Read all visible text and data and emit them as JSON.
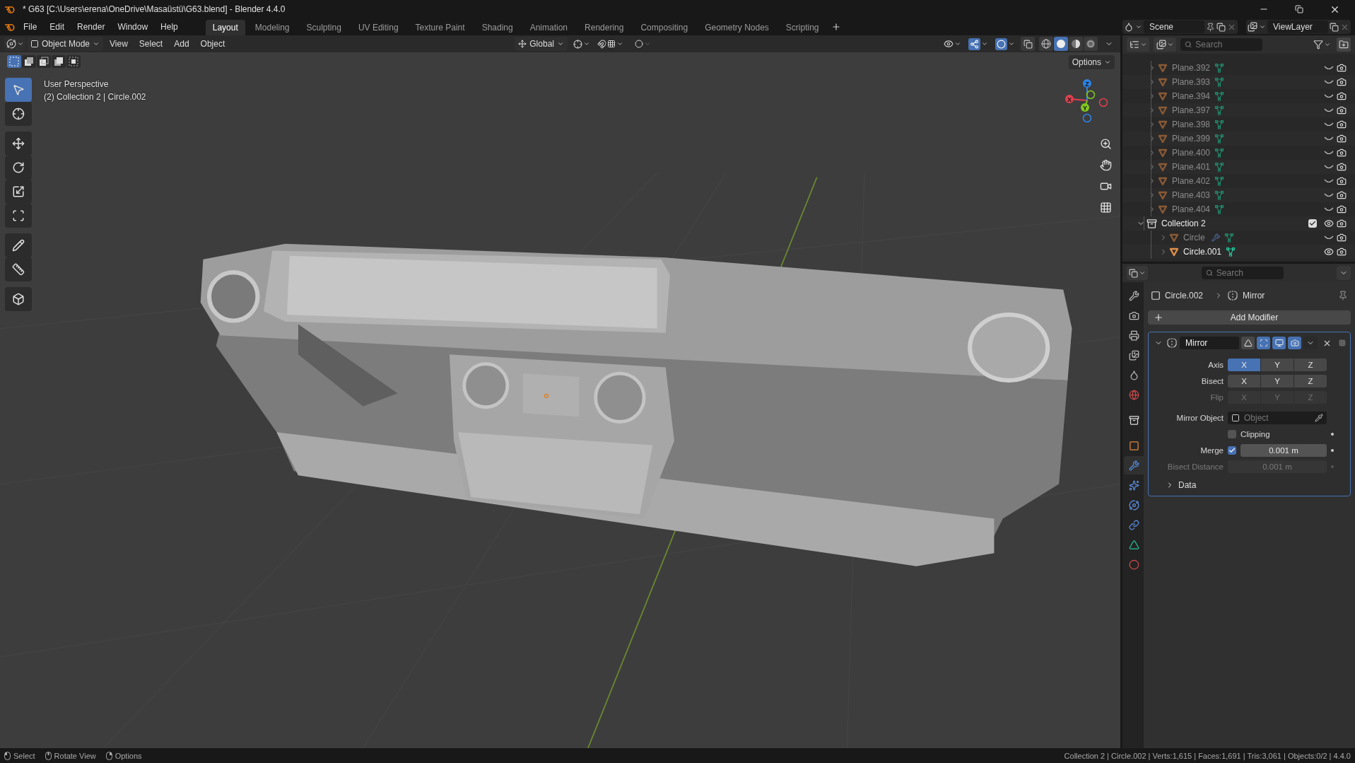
{
  "window": {
    "title": "* G63 [C:\\Users\\erena\\OneDrive\\Masaüstü\\G63.blend] - Blender 4.4.0"
  },
  "menu": [
    "File",
    "Edit",
    "Render",
    "Window",
    "Help"
  ],
  "workspaces": [
    {
      "label": "Layout",
      "selected": true
    },
    {
      "label": "Modeling",
      "selected": false
    },
    {
      "label": "Sculpting",
      "selected": false
    },
    {
      "label": "UV Editing",
      "selected": false
    },
    {
      "label": "Texture Paint",
      "selected": false
    },
    {
      "label": "Shading",
      "selected": false
    },
    {
      "label": "Animation",
      "selected": false
    },
    {
      "label": "Rendering",
      "selected": false
    },
    {
      "label": "Compositing",
      "selected": false
    },
    {
      "label": "Geometry Nodes",
      "selected": false
    },
    {
      "label": "Scripting",
      "selected": false
    }
  ],
  "scene": "Scene",
  "view_layer": "ViewLayer",
  "viewport": {
    "gizmos": true,
    "overlays": true,
    "mode": "Object Mode",
    "menus": [
      "View",
      "Select",
      "Add",
      "Object"
    ],
    "orientation": "Global",
    "options": "Options",
    "select_modes": [
      {
        "kind": "set",
        "selected": true
      },
      {
        "kind": "extend",
        "selected": false
      },
      {
        "kind": "subtract",
        "selected": false
      },
      {
        "kind": "difference",
        "selected": false
      },
      {
        "kind": "intersect",
        "selected": false
      }
    ],
    "shading": [
      {
        "kind": "wireframe",
        "selected": false
      },
      {
        "kind": "solid",
        "selected": true
      },
      {
        "kind": "material",
        "selected": false
      },
      {
        "kind": "rendered",
        "selected": false
      }
    ],
    "overlay_text": [
      "User Perspective",
      "(2) Collection 2 | Circle.002"
    ],
    "tools": [
      {
        "kind": "select",
        "selected": true
      },
      {
        "kind": "cursor",
        "selected": false
      },
      {
        "kind": "move",
        "selected": false
      },
      {
        "kind": "rotate",
        "selected": false
      },
      {
        "kind": "scale",
        "selected": false
      },
      {
        "kind": "transform",
        "selected": false
      },
      {
        "kind": "annotate",
        "selected": false
      },
      {
        "kind": "measure",
        "selected": false
      },
      {
        "kind": "add_cube",
        "selected": false
      }
    ],
    "gizmo_axes": [
      {
        "label": "X",
        "color": "#e0404f"
      },
      {
        "label": "Y",
        "color": "#82c81e"
      },
      {
        "label": "Z",
        "color": "#2f83e3"
      }
    ]
  },
  "outliner": {
    "search": {
      "placeholder": "Search"
    },
    "items": [
      {
        "kind": "mesh",
        "name": "Plane.392",
        "visible": false,
        "modifier": false
      },
      {
        "kind": "mesh",
        "name": "Plane.393",
        "visible": false,
        "modifier": false
      },
      {
        "kind": "mesh",
        "name": "Plane.394",
        "visible": false,
        "modifier": false
      },
      {
        "kind": "mesh",
        "name": "Plane.397",
        "visible": false,
        "modifier": false
      },
      {
        "kind": "mesh",
        "name": "Plane.398",
        "visible": false,
        "modifier": false
      },
      {
        "kind": "mesh",
        "name": "Plane.399",
        "visible": false,
        "modifier": false
      },
      {
        "kind": "mesh",
        "name": "Plane.400",
        "visible": false,
        "modifier": false
      },
      {
        "kind": "mesh",
        "name": "Plane.401",
        "visible": false,
        "modifier": false
      },
      {
        "kind": "mesh",
        "name": "Plane.402",
        "visible": false,
        "modifier": false
      },
      {
        "kind": "mesh",
        "name": "Plane.403",
        "visible": false,
        "modifier": false
      },
      {
        "kind": "mesh",
        "name": "Plane.404",
        "visible": false,
        "modifier": false
      },
      {
        "kind": "collection",
        "name": "Collection 2",
        "visible": true,
        "checked": true,
        "expanded": true,
        "children": [
          {
            "kind": "mesh",
            "name": "Circle",
            "visible": false,
            "modifier": true
          },
          {
            "kind": "mesh",
            "name": "Circle.001",
            "visible": true,
            "modifier": false
          }
        ]
      }
    ]
  },
  "properties": {
    "search": {
      "placeholder": "Search"
    },
    "tabs": [
      {
        "kind": "tool",
        "selected": false
      },
      {
        "kind": "render",
        "selected": false
      },
      {
        "kind": "output",
        "selected": false
      },
      {
        "kind": "view_layer",
        "selected": false
      },
      {
        "kind": "scene",
        "selected": false
      },
      {
        "kind": "world",
        "selected": false
      },
      {
        "kind": "collection",
        "selected": false
      },
      {
        "kind": "object",
        "selected": false
      },
      {
        "kind": "modifiers",
        "selected": true
      },
      {
        "kind": "particles",
        "selected": false
      },
      {
        "kind": "physics",
        "selected": false
      },
      {
        "kind": "constraints",
        "selected": false
      },
      {
        "kind": "data",
        "selected": false
      },
      {
        "kind": "material",
        "selected": false
      }
    ],
    "breadcrumb": {
      "object": "Circle.002",
      "modifier": "Mirror"
    },
    "add_modifier": "Add Modifier",
    "modifier": {
      "name": "Mirror",
      "expanded": true,
      "toggles": [
        {
          "kind": "edit_mode",
          "on": false
        },
        {
          "kind": "on_cage",
          "on": true
        },
        {
          "kind": "viewport",
          "on": true
        },
        {
          "kind": "render",
          "on": true
        }
      ],
      "rows": [
        {
          "kind": "axes",
          "label": "Axis",
          "disabled": false,
          "buttons": [
            {
              "label": "X",
              "on": true
            },
            {
              "label": "Y",
              "on": false
            },
            {
              "label": "Z",
              "on": false
            }
          ]
        },
        {
          "kind": "axes",
          "label": "Bisect",
          "disabled": false,
          "buttons": [
            {
              "label": "X",
              "on": false
            },
            {
              "label": "Y",
              "on": false
            },
            {
              "label": "Z",
              "on": false
            }
          ]
        },
        {
          "kind": "axes",
          "label": "Flip",
          "disabled": true,
          "buttons": [
            {
              "label": "X",
              "on": false
            },
            {
              "label": "Y",
              "on": false
            },
            {
              "label": "Z",
              "on": false
            }
          ]
        },
        {
          "kind": "object",
          "label": "Mirror Object",
          "placeholder": "Object"
        },
        {
          "kind": "checkbox",
          "label": "Clipping",
          "checked": false
        },
        {
          "kind": "checkbox_value",
          "label": "Merge",
          "checked": true,
          "value": "0.001 m"
        },
        {
          "kind": "value",
          "label": "Bisect Distance",
          "value": "0.001 m",
          "disabled": true
        }
      ],
      "subpanel": {
        "label": "Data",
        "expanded": false
      }
    }
  },
  "status_bar": {
    "hints": [
      {
        "kind": "left",
        "label": "Select"
      },
      {
        "kind": "middle",
        "label": "Rotate View"
      },
      {
        "kind": "right",
        "label": "Options"
      }
    ],
    "stats": "Collection 2 | Circle.002 | Verts:1,615 | Faces:1,691 | Tris:3,061 | Objects:0/2 | 4.4.0"
  }
}
